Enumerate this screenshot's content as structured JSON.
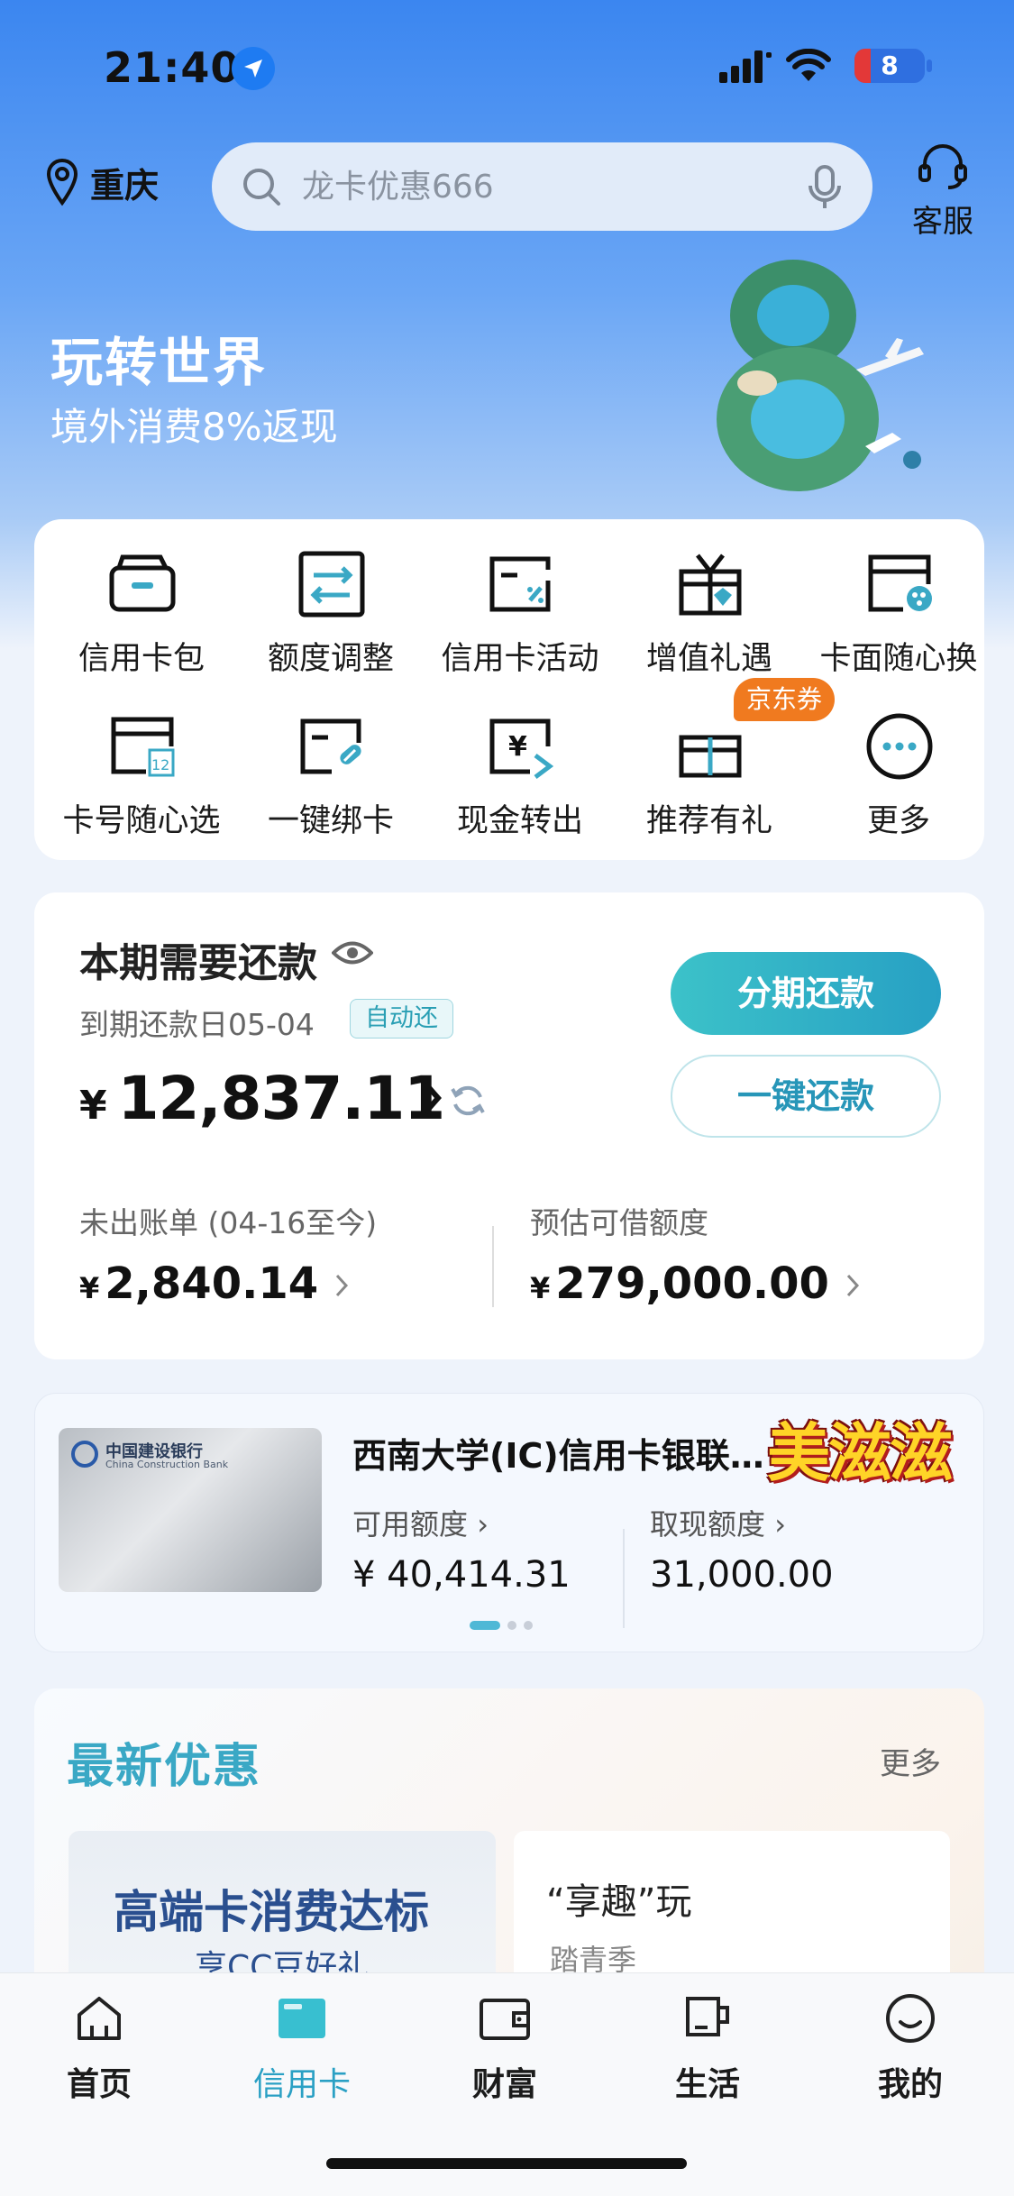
{
  "status_bar": {
    "time": "21:40",
    "battery": "8"
  },
  "header": {
    "city": "重庆",
    "search_placeholder": "龙卡优惠666",
    "service_label": "客服"
  },
  "banner": {
    "title": "玩转世界",
    "subtitle": "境外消费8%返现"
  },
  "quick_grid": {
    "items": [
      {
        "label": "信用卡包",
        "icon": "card-wallet-icon"
      },
      {
        "label": "额度调整",
        "icon": "adjust-limit-icon"
      },
      {
        "label": "信用卡活动",
        "icon": "card-activity-icon"
      },
      {
        "label": "增值礼遇",
        "icon": "gift-benefit-icon"
      },
      {
        "label": "卡面随心换",
        "icon": "card-face-icon"
      },
      {
        "label": "卡号随心选",
        "icon": "card-number-icon"
      },
      {
        "label": "一键绑卡",
        "icon": "bind-card-icon"
      },
      {
        "label": "现金转出",
        "icon": "cash-transfer-icon"
      },
      {
        "label": "推荐有礼",
        "icon": "referral-gift-icon"
      },
      {
        "label": "更多",
        "icon": "more-icon"
      }
    ],
    "badge": "京东券"
  },
  "repayment": {
    "title": "本期需要还款",
    "due_label": "到期还款日05-04",
    "auto_badge": "自动还",
    "currency": "¥",
    "amount": "12,837.11",
    "installment_button": "分期还款",
    "repay_button": "一键还款",
    "unbilled_label": "未出账单 (04-16至今)",
    "unbilled_value": "2,840.14",
    "borrow_label": "预估可借额度",
    "borrow_value": "279,000.00"
  },
  "card_info": {
    "card_name": "西南大学(IC)信用卡银联…",
    "bank_name": "中国建设银行",
    "bank_name_en": "China Construction Bank",
    "sticker_text": "美滋滋",
    "available_label": "可用额度",
    "available_value": "¥ 40,414.31",
    "cash_label": "取现额度",
    "cash_value": "31,000.00"
  },
  "promos": {
    "title": "最新优惠",
    "more": "更多",
    "card1_title": "高端卡消费达标",
    "card1_sub": "享CC豆好礼",
    "card2_title": "“享趣”玩",
    "card2_sub": "踏青季"
  },
  "tabbar": {
    "items": [
      {
        "label": "首页",
        "active": false
      },
      {
        "label": "信用卡",
        "active": true
      },
      {
        "label": "财富",
        "active": false
      },
      {
        "label": "生活",
        "active": false
      },
      {
        "label": "我的",
        "active": false
      }
    ]
  },
  "colors": {
    "accent": "#2aa0c4",
    "brand_blue": "#3b86f0",
    "badge_orange": "#f07a1f"
  }
}
